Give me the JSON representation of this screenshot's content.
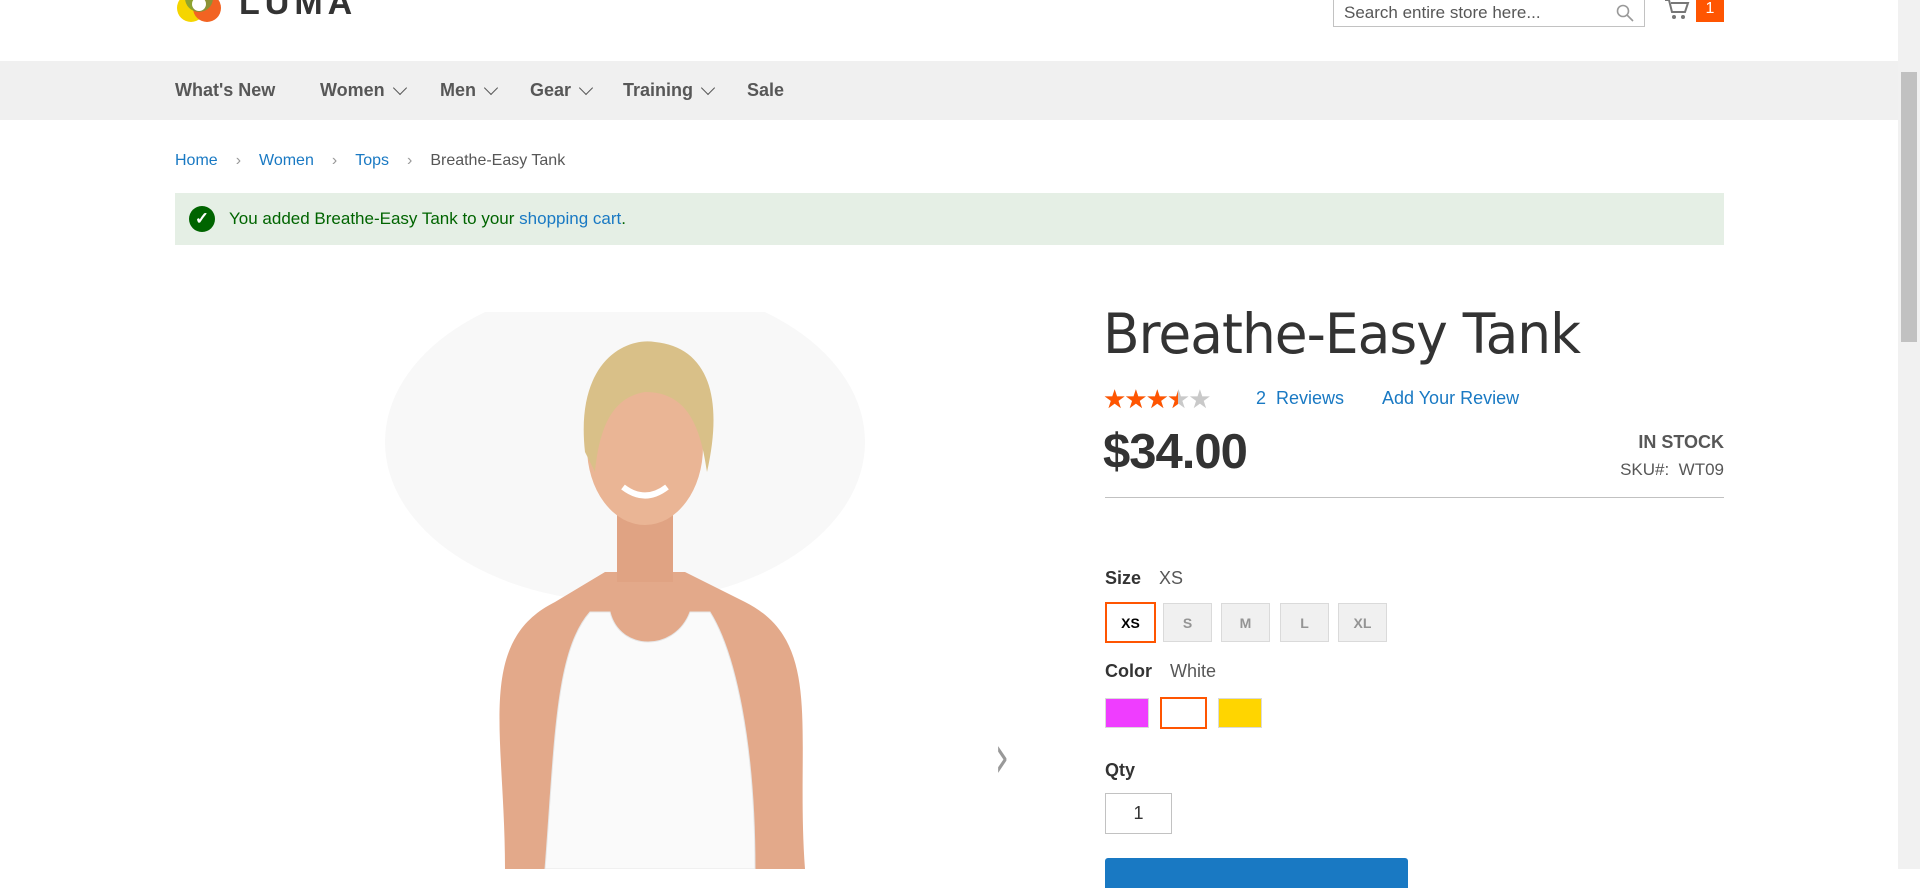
{
  "header": {
    "logo_text": "LUMA",
    "search_placeholder": "Search entire store here...",
    "cart_count": "1"
  },
  "nav": [
    {
      "label": "What's New"
    },
    {
      "label": "Women"
    },
    {
      "label": "Men"
    },
    {
      "label": "Gear"
    },
    {
      "label": "Training"
    },
    {
      "label": "Sale"
    }
  ],
  "breadcrumb": [
    "Home",
    "Women",
    "Tops",
    "Breathe-Easy Tank"
  ],
  "message": {
    "prefix": "You added Breathe-Easy Tank to your ",
    "link": "shopping cart",
    "suffix": "."
  },
  "product": {
    "title": "Breathe-Easy Tank",
    "rating_fraction": 0.7,
    "reviews_count": "2",
    "reviews_label": "Reviews",
    "add_review": "Add Your Review",
    "price": "$34.00",
    "stock": "IN STOCK",
    "sku_label": "SKU#:",
    "sku": "WT09"
  },
  "size": {
    "label": "Size",
    "selected": "XS",
    "options": [
      "XS",
      "S",
      "M",
      "L",
      "XL"
    ]
  },
  "color": {
    "label": "Color",
    "selected": "White",
    "options": [
      {
        "name": "Purple",
        "hex": "#ef3dff"
      },
      {
        "name": "White",
        "hex": "#ffffff"
      },
      {
        "name": "Yellow",
        "hex": "#ffd500"
      }
    ]
  },
  "qty": {
    "label": "Qty",
    "value": "1"
  }
}
